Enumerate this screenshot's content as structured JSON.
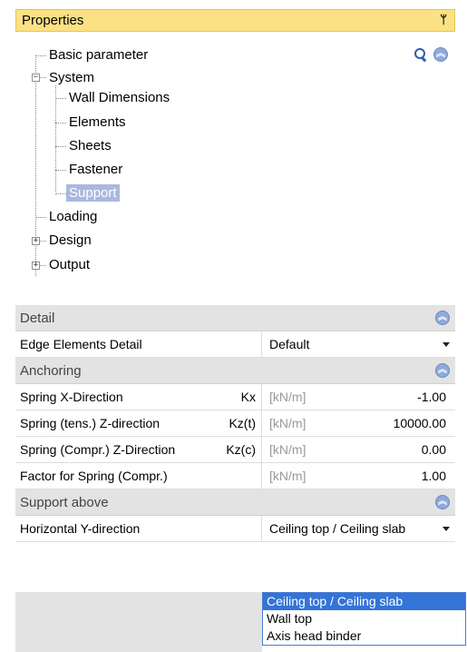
{
  "panel": {
    "title": "Properties"
  },
  "tree": {
    "items": [
      {
        "label": "Basic parameter"
      },
      {
        "label": "System"
      },
      {
        "label": "Wall Dimensions"
      },
      {
        "label": "Elements"
      },
      {
        "label": "Sheets"
      },
      {
        "label": "Fastener"
      },
      {
        "label": "Support"
      },
      {
        "label": "Loading"
      },
      {
        "label": "Design"
      },
      {
        "label": "Output"
      }
    ],
    "selected": "Support"
  },
  "grid": {
    "detail": {
      "header": "Detail",
      "rows": [
        {
          "name": "Edge Elements Detail",
          "value": "Default"
        }
      ]
    },
    "anchoring": {
      "header": "Anchoring",
      "rows": [
        {
          "name": "Spring X-Direction",
          "symbol": "Kx",
          "unit": "[kN/m]",
          "value": "-1.00"
        },
        {
          "name": "Spring (tens.) Z-direction",
          "symbol": "Kz(t)",
          "unit": "[kN/m]",
          "value": "10000.00"
        },
        {
          "name": "Spring (Compr.) Z-Direction",
          "symbol": "Kz(c)",
          "unit": "[kN/m]",
          "value": "0.00"
        },
        {
          "name": "Factor for Spring (Compr.)",
          "symbol": "",
          "unit": "[kN/m]",
          "value": "1.00"
        }
      ]
    },
    "support_above": {
      "header": "Support above",
      "rows": [
        {
          "name": "Horizontal Y-direction",
          "value": "Ceiling top / Ceiling slab"
        }
      ]
    }
  },
  "dropdown": {
    "options": [
      "Ceiling top / Ceiling slab",
      "Wall top",
      "Axis head binder"
    ],
    "selected": "Ceiling top / Ceiling slab"
  },
  "icons": {
    "pin": "pin-icon",
    "search": "search-icon",
    "collapse": "collapse-icon"
  },
  "colors": {
    "title_bg": "#fbe184",
    "selection": "#aab8e0",
    "dropdown_selection": "#3374d6"
  }
}
